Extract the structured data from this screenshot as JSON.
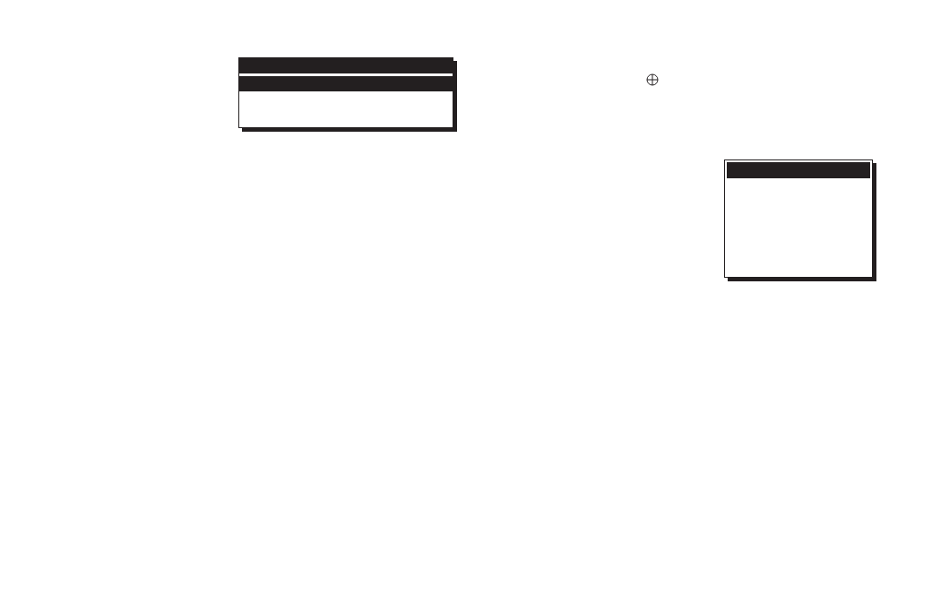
{
  "dialogs": [
    {
      "kind": "double-bar"
    },
    {
      "kind": "single-bar"
    }
  ],
  "marker": {
    "kind": "crosshair"
  }
}
